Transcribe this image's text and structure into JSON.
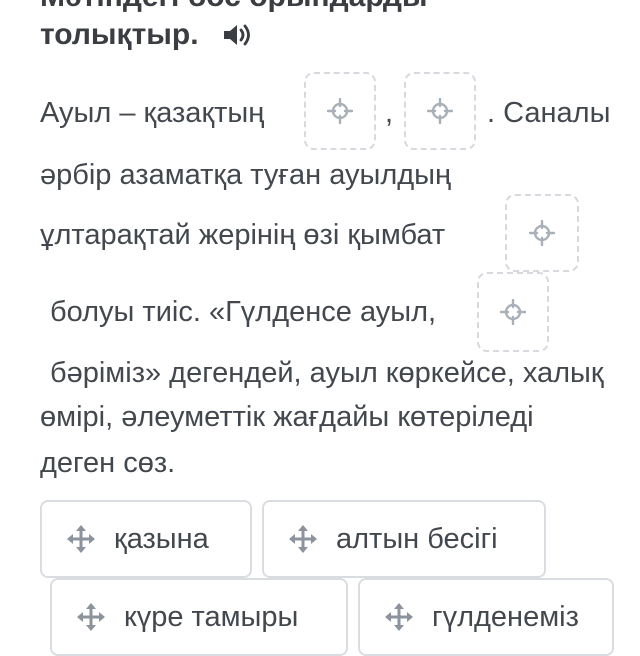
{
  "task": {
    "title_cut": "Мәтіндегі бос орындарды",
    "title": "толықтыр."
  },
  "icons": {
    "audio": "speaker-icon",
    "slot": "crosshair-move-icon",
    "chip": "move-arrows-icon"
  },
  "text": {
    "l1_a": "Ауыл – қазақтың",
    "l1_comma": ",",
    "l1_b": ". Саналы",
    "l2": "әрбір азаматқа туған ауылдың",
    "l3": "ұлтарақтай жерінің өзі қымбат",
    "l4": "болуы тиіс. «Гүлденсе ауыл,",
    "l5": "бәріміз» дегендей, ауыл көркейсе, халық",
    "l6": "өмірі, әлеуметтік жағдайы көтеріледі",
    "l7": "деген сөз."
  },
  "options": [
    "қазына",
    "алтын бесігі",
    "күре тамыры",
    "гүлденеміз"
  ],
  "colors": {
    "text": "#43484e",
    "icon": "#aab0b8",
    "chip_icon": "#8c939c",
    "slot_border": "#d6d9de",
    "chip_border": "#d9dde2"
  }
}
